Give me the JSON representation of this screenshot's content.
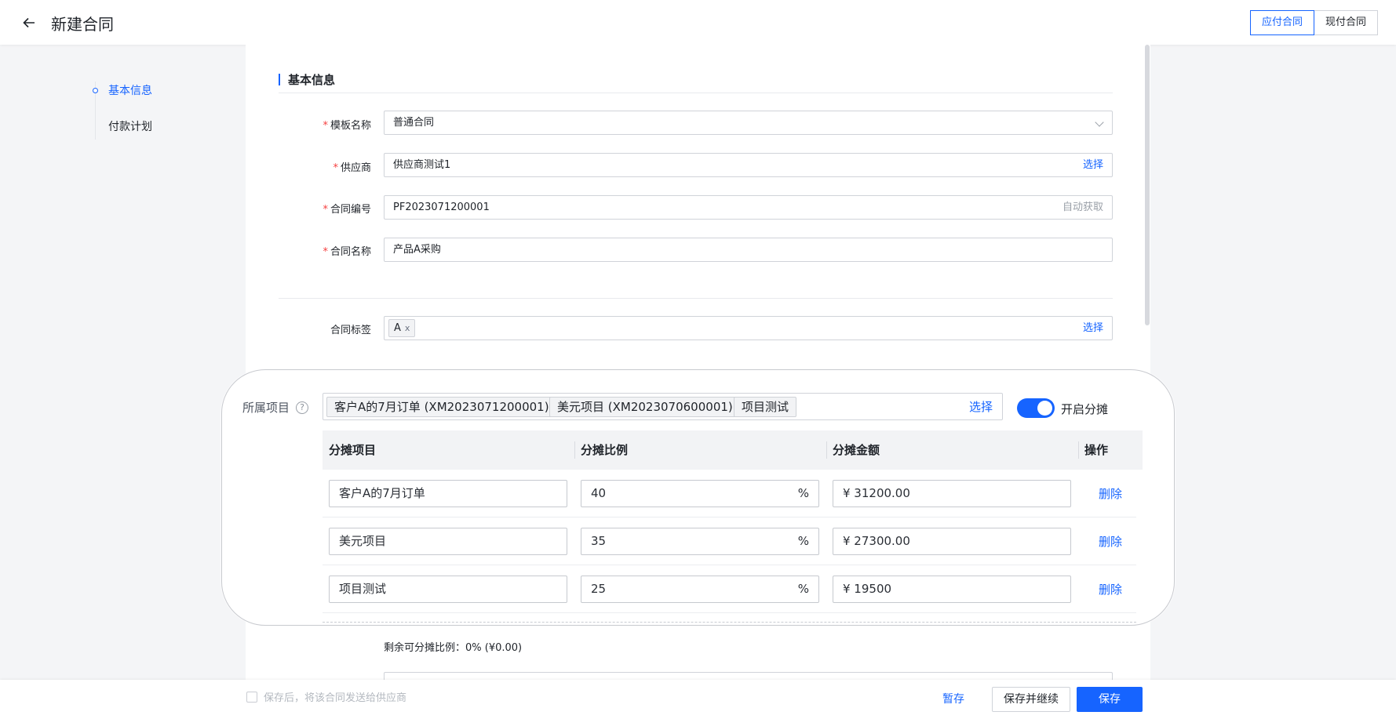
{
  "header": {
    "title": "新建合同",
    "tabs": [
      {
        "label": "应付合同",
        "active": true
      },
      {
        "label": "现付合同",
        "active": false
      }
    ]
  },
  "nav": {
    "items": [
      {
        "label": "基本信息",
        "active": true
      },
      {
        "label": "付款计划",
        "active": false
      }
    ]
  },
  "section": {
    "title": "基本信息"
  },
  "form": {
    "template": {
      "label": "模板名称",
      "value": "普通合同"
    },
    "supplier": {
      "label": "供应商",
      "value": "供应商测试1",
      "action": "选择"
    },
    "contract_no": {
      "label": "合同编号",
      "value": "PF2023071200001",
      "action": "自动获取"
    },
    "contract_name": {
      "label": "合同名称",
      "value": "产品A采购"
    },
    "tags": {
      "label": "合同标签",
      "chips": [
        "A"
      ],
      "remove": "x",
      "action": "选择"
    }
  },
  "project": {
    "label": "所属项目",
    "help": "?",
    "chips": [
      "客户A的7月订单 (XM2023071200001)",
      "美元项目 (XM2023070600001)",
      "项目测试"
    ],
    "action": "选择",
    "toggle": {
      "label": "开启分摊",
      "on": true
    }
  },
  "allocation": {
    "columns": [
      "分摊项目",
      "分摊比例",
      "分摊金额",
      "操作"
    ],
    "rows": [
      {
        "project": "客户A的7月订单",
        "ratio": "40",
        "unit": "%",
        "amount": "¥  31200.00",
        "action": "删除"
      },
      {
        "project": "美元项目",
        "ratio": "35",
        "unit": "%",
        "amount": "¥  27300.00",
        "action": "删除"
      },
      {
        "project": "项目测试",
        "ratio": "25",
        "unit": "%",
        "amount": "¥  19500",
        "action": "删除"
      }
    ],
    "remaining": "剩余可分摊比例：0% (¥0.00)"
  },
  "footer": {
    "send_label": "保存后，将该合同发送给供应商",
    "draft": "暂存",
    "save_continue": "保存并继续",
    "save": "保存"
  },
  "colors": {
    "accent": "#1664ff",
    "required": "#f53f3f"
  }
}
